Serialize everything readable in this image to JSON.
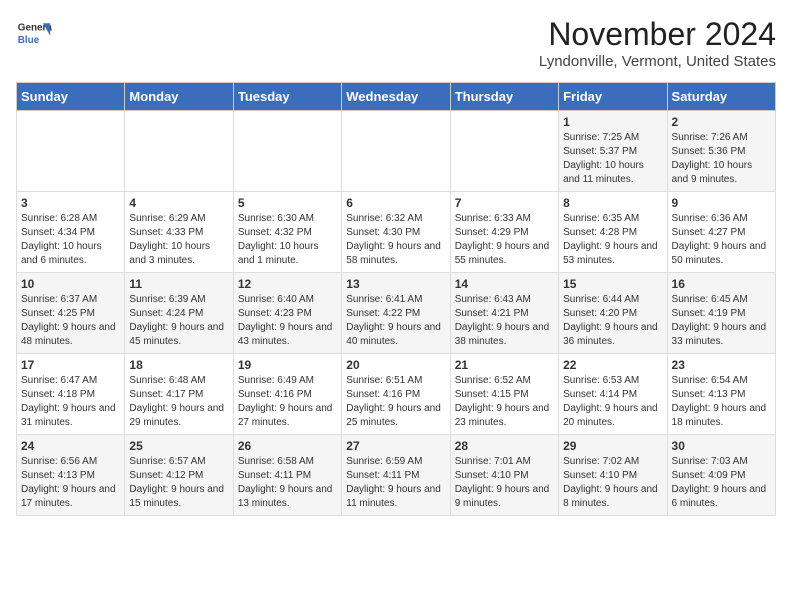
{
  "logo": {
    "line1": "General",
    "line2": "Blue"
  },
  "title": "November 2024",
  "subtitle": "Lyndonville, Vermont, United States",
  "days_of_week": [
    "Sunday",
    "Monday",
    "Tuesday",
    "Wednesday",
    "Thursday",
    "Friday",
    "Saturday"
  ],
  "weeks": [
    [
      {
        "day": "",
        "info": ""
      },
      {
        "day": "",
        "info": ""
      },
      {
        "day": "",
        "info": ""
      },
      {
        "day": "",
        "info": ""
      },
      {
        "day": "",
        "info": ""
      },
      {
        "day": "1",
        "info": "Sunrise: 7:25 AM\nSunset: 5:37 PM\nDaylight: 10 hours and 11 minutes."
      },
      {
        "day": "2",
        "info": "Sunrise: 7:26 AM\nSunset: 5:36 PM\nDaylight: 10 hours and 9 minutes."
      }
    ],
    [
      {
        "day": "3",
        "info": "Sunrise: 6:28 AM\nSunset: 4:34 PM\nDaylight: 10 hours and 6 minutes."
      },
      {
        "day": "4",
        "info": "Sunrise: 6:29 AM\nSunset: 4:33 PM\nDaylight: 10 hours and 3 minutes."
      },
      {
        "day": "5",
        "info": "Sunrise: 6:30 AM\nSunset: 4:32 PM\nDaylight: 10 hours and 1 minute."
      },
      {
        "day": "6",
        "info": "Sunrise: 6:32 AM\nSunset: 4:30 PM\nDaylight: 9 hours and 58 minutes."
      },
      {
        "day": "7",
        "info": "Sunrise: 6:33 AM\nSunset: 4:29 PM\nDaylight: 9 hours and 55 minutes."
      },
      {
        "day": "8",
        "info": "Sunrise: 6:35 AM\nSunset: 4:28 PM\nDaylight: 9 hours and 53 minutes."
      },
      {
        "day": "9",
        "info": "Sunrise: 6:36 AM\nSunset: 4:27 PM\nDaylight: 9 hours and 50 minutes."
      }
    ],
    [
      {
        "day": "10",
        "info": "Sunrise: 6:37 AM\nSunset: 4:25 PM\nDaylight: 9 hours and 48 minutes."
      },
      {
        "day": "11",
        "info": "Sunrise: 6:39 AM\nSunset: 4:24 PM\nDaylight: 9 hours and 45 minutes."
      },
      {
        "day": "12",
        "info": "Sunrise: 6:40 AM\nSunset: 4:23 PM\nDaylight: 9 hours and 43 minutes."
      },
      {
        "day": "13",
        "info": "Sunrise: 6:41 AM\nSunset: 4:22 PM\nDaylight: 9 hours and 40 minutes."
      },
      {
        "day": "14",
        "info": "Sunrise: 6:43 AM\nSunset: 4:21 PM\nDaylight: 9 hours and 38 minutes."
      },
      {
        "day": "15",
        "info": "Sunrise: 6:44 AM\nSunset: 4:20 PM\nDaylight: 9 hours and 36 minutes."
      },
      {
        "day": "16",
        "info": "Sunrise: 6:45 AM\nSunset: 4:19 PM\nDaylight: 9 hours and 33 minutes."
      }
    ],
    [
      {
        "day": "17",
        "info": "Sunrise: 6:47 AM\nSunset: 4:18 PM\nDaylight: 9 hours and 31 minutes."
      },
      {
        "day": "18",
        "info": "Sunrise: 6:48 AM\nSunset: 4:17 PM\nDaylight: 9 hours and 29 minutes."
      },
      {
        "day": "19",
        "info": "Sunrise: 6:49 AM\nSunset: 4:16 PM\nDaylight: 9 hours and 27 minutes."
      },
      {
        "day": "20",
        "info": "Sunrise: 6:51 AM\nSunset: 4:16 PM\nDaylight: 9 hours and 25 minutes."
      },
      {
        "day": "21",
        "info": "Sunrise: 6:52 AM\nSunset: 4:15 PM\nDaylight: 9 hours and 23 minutes."
      },
      {
        "day": "22",
        "info": "Sunrise: 6:53 AM\nSunset: 4:14 PM\nDaylight: 9 hours and 20 minutes."
      },
      {
        "day": "23",
        "info": "Sunrise: 6:54 AM\nSunset: 4:13 PM\nDaylight: 9 hours and 18 minutes."
      }
    ],
    [
      {
        "day": "24",
        "info": "Sunrise: 6:56 AM\nSunset: 4:13 PM\nDaylight: 9 hours and 17 minutes."
      },
      {
        "day": "25",
        "info": "Sunrise: 6:57 AM\nSunset: 4:12 PM\nDaylight: 9 hours and 15 minutes."
      },
      {
        "day": "26",
        "info": "Sunrise: 6:58 AM\nSunset: 4:11 PM\nDaylight: 9 hours and 13 minutes."
      },
      {
        "day": "27",
        "info": "Sunrise: 6:59 AM\nSunset: 4:11 PM\nDaylight: 9 hours and 11 minutes."
      },
      {
        "day": "28",
        "info": "Sunrise: 7:01 AM\nSunset: 4:10 PM\nDaylight: 9 hours and 9 minutes."
      },
      {
        "day": "29",
        "info": "Sunrise: 7:02 AM\nSunset: 4:10 PM\nDaylight: 9 hours and 8 minutes."
      },
      {
        "day": "30",
        "info": "Sunrise: 7:03 AM\nSunset: 4:09 PM\nDaylight: 9 hours and 6 minutes."
      }
    ]
  ]
}
